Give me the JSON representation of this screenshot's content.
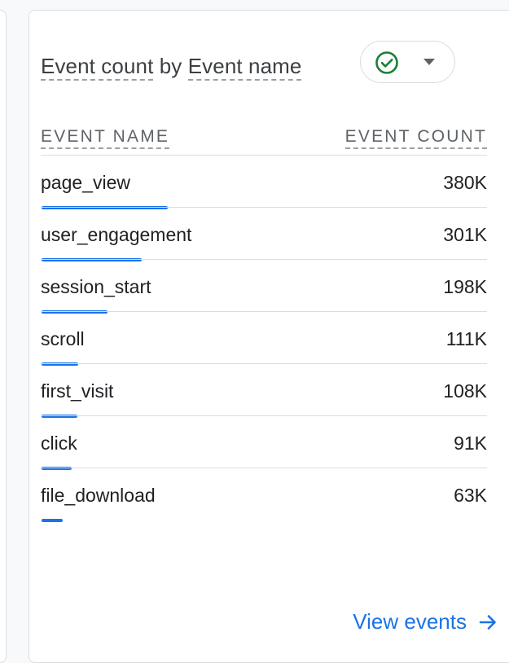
{
  "card": {
    "title_part1": "Event count",
    "title_by": " by ",
    "title_part2": "Event name",
    "status_icon": "check-circle-icon",
    "dropdown_icon": "caret-down-icon",
    "status_color": "#188038"
  },
  "table": {
    "col_name_header": "EVENT NAME",
    "col_count_header": "EVENT COUNT",
    "bar_color": "#1a73e8",
    "rows": [
      {
        "name": "page_view",
        "value": "380K",
        "count": 380
      },
      {
        "name": "user_engagement",
        "value": "301K",
        "count": 301
      },
      {
        "name": "session_start",
        "value": "198K",
        "count": 198
      },
      {
        "name": "scroll",
        "value": "111K",
        "count": 111
      },
      {
        "name": "first_visit",
        "value": "108K",
        "count": 108
      },
      {
        "name": "click",
        "value": "91K",
        "count": 91
      },
      {
        "name": "file_download",
        "value": "63K",
        "count": 63
      }
    ]
  },
  "footer": {
    "view_link_label": "View events",
    "link_icon": "arrow-right-icon",
    "link_color": "#1a73e8"
  }
}
